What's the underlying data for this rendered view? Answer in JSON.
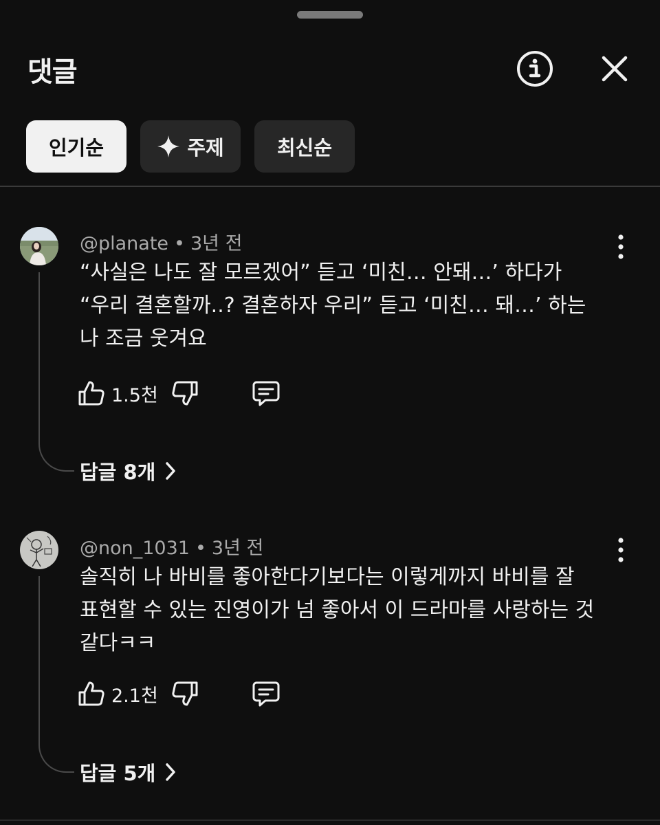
{
  "header": {
    "title": "댓글"
  },
  "tabs": [
    {
      "label": "인기순",
      "active": true
    },
    {
      "label": "주제",
      "icon": "sparkle-icon",
      "active": false
    },
    {
      "label": "최신순",
      "active": false
    }
  ],
  "comments": [
    {
      "author": "@planate",
      "separator": "•",
      "time": "3년 전",
      "lines": [
        "“사실은 나도 잘 모르겠어” 듣고 ‘미친… 안돼…’ 하다가",
        "“우리 결혼할까..? 결혼하자 우리” 듣고 ‘미친… 돼…’ 하는",
        "나 조금 웃겨요"
      ],
      "likes": "1.5천",
      "replies": "답글 8개"
    },
    {
      "author": "@non_1031",
      "separator": "•",
      "time": "3년 전",
      "lines": [
        "솔직히 나 바비를 좋아한다기보다는 이렇게까지 바비를 잘",
        "표현할 수 있는 진영이가 넘 좋아서 이 드라마를 사랑하는 것",
        "같다ㅋㅋ"
      ],
      "likes": "2.1천",
      "replies": "답글 5개"
    }
  ],
  "colors": {
    "background": "#0f0f0f",
    "chip": "#272727",
    "chip_active": "#f1f1f1",
    "secondary_text": "#aaaaaa"
  }
}
